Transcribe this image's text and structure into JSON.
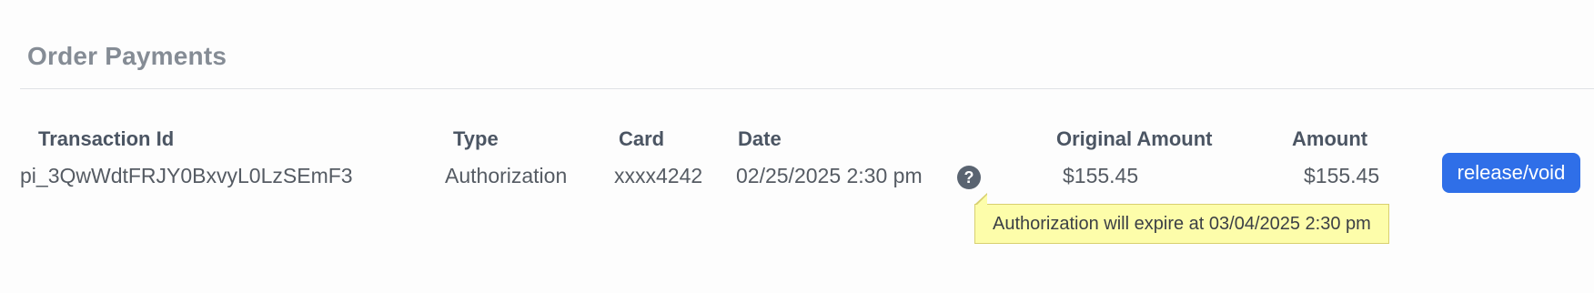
{
  "section": {
    "title": "Order Payments"
  },
  "table": {
    "headers": {
      "transaction_id": "Transaction Id",
      "type": "Type",
      "card": "Card",
      "date": "Date",
      "original_amount": "Original Amount",
      "amount": "Amount"
    },
    "rows": [
      {
        "transaction_id": "pi_3QwWdtFRJY0BxvyL0LzSEmF3",
        "type": "Authorization",
        "card": "xxxx4242",
        "date": "02/25/2025 2:30 pm",
        "help_icon_glyph": "?",
        "original_amount": "$155.45",
        "amount": "$155.45",
        "action_label": "release/void"
      }
    ]
  },
  "tooltip": {
    "text": "Authorization will expire at 03/04/2025 2:30 pm"
  },
  "icons": {
    "help": "question-circle-icon"
  },
  "colors": {
    "primary_button": "#2f6fe8",
    "tooltip_background": "#fdfdaa",
    "title": "#858c95"
  }
}
